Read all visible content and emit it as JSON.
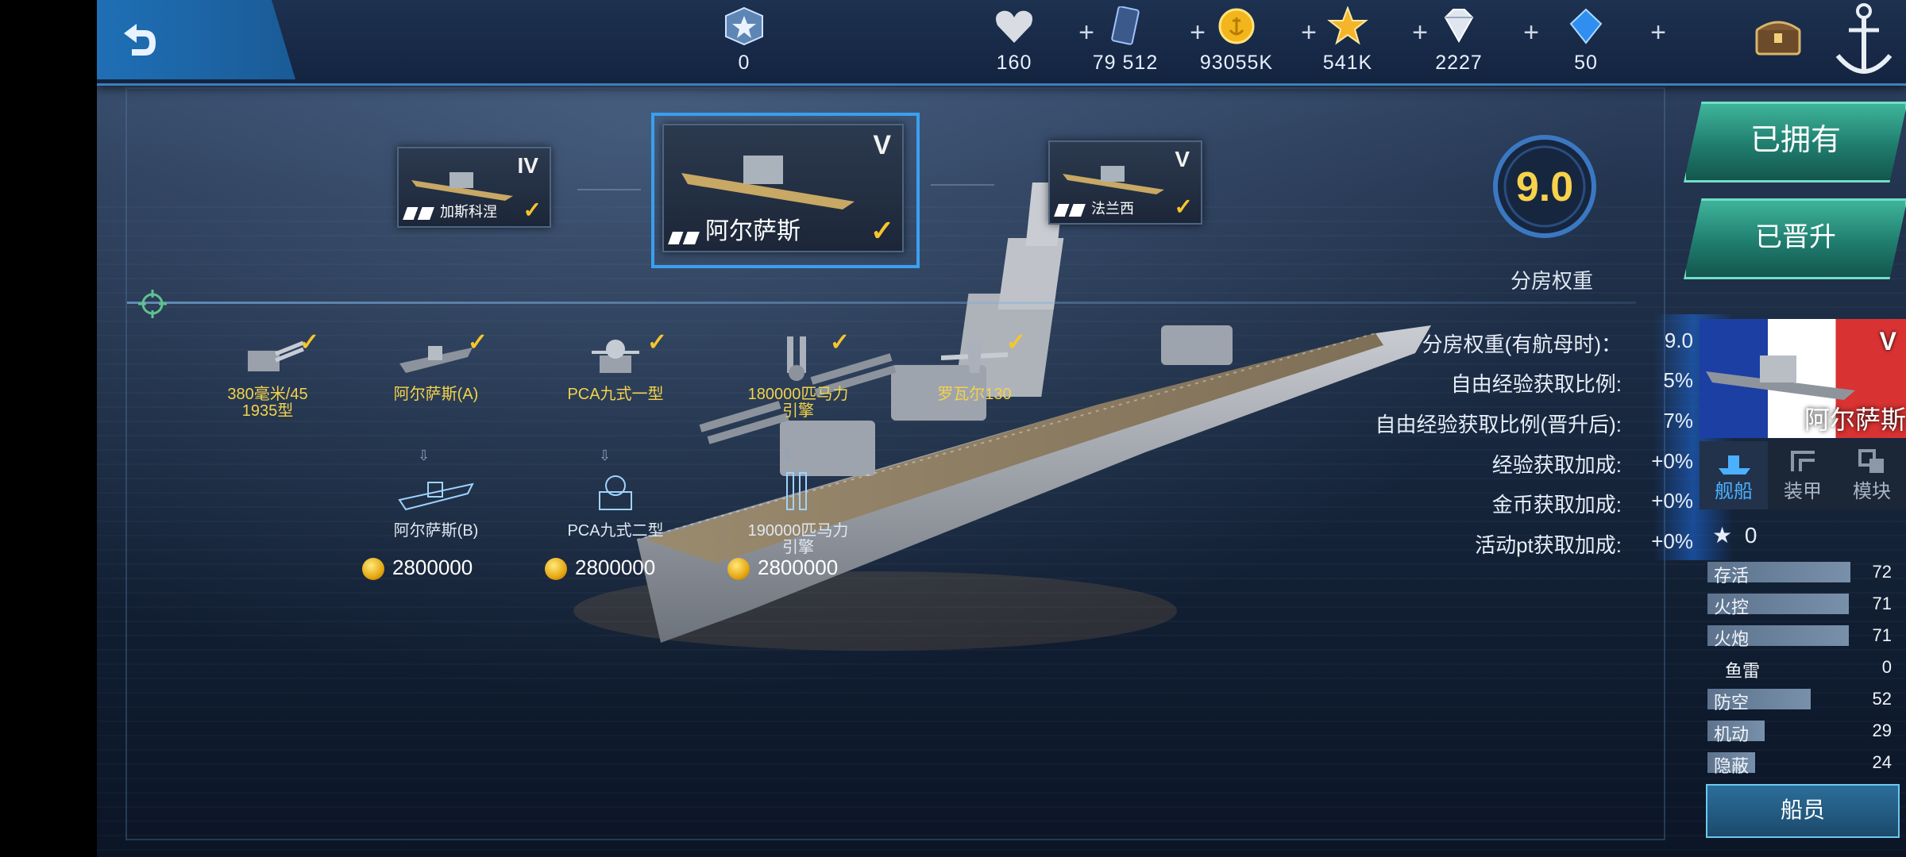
{
  "top": {
    "resources": [
      {
        "icon": "rank-badge-icon",
        "value": "0"
      },
      {
        "icon": "heart-icon",
        "value": "160"
      },
      {
        "icon": "blueprint-card-icon",
        "value": "79 512"
      },
      {
        "icon": "gold-coin-icon",
        "value": "93055K"
      },
      {
        "icon": "gold-star-icon",
        "value": "541K"
      },
      {
        "icon": "silver-diamond-icon",
        "value": "2227"
      },
      {
        "icon": "blue-gem-icon",
        "value": "50"
      }
    ],
    "plus": "+"
  },
  "tree": {
    "ships": [
      {
        "tier": "IV",
        "name": "加斯科涅"
      },
      {
        "tier": "V",
        "name": "阿尔萨斯"
      },
      {
        "tier": "V",
        "name": "法兰西"
      }
    ],
    "check": "✓"
  },
  "modules": {
    "owned": [
      {
        "label1": "380毫米/45",
        "label2": "1935型"
      },
      {
        "label1": "阿尔萨斯(A)",
        "label2": ""
      },
      {
        "label1": "PCA九式一型",
        "label2": ""
      },
      {
        "label1": "180000匹马力",
        "label2": "引擎"
      },
      {
        "label1": "罗瓦尔130",
        "label2": ""
      }
    ],
    "upgrades": [
      {
        "label1": "阿尔萨斯(B)",
        "label2": "",
        "price": "2800000"
      },
      {
        "label1": "PCA九式二型",
        "label2": "",
        "price": "2800000"
      },
      {
        "label1": "190000匹马力",
        "label2": "引擎",
        "price": "2800000"
      }
    ]
  },
  "stats": {
    "rating": "9.0",
    "rating_label": "分房权重",
    "rows": [
      {
        "k": "分房权重(有航母时)：",
        "v": "9.0"
      },
      {
        "k": "自由经验获取比例:",
        "v": "5%"
      },
      {
        "k": "自由经验获取比例(晋升后):",
        "v": "7%"
      },
      {
        "k": "经验获取加成:",
        "v": "+0%"
      },
      {
        "k": "金币获取加成:",
        "v": "+0%"
      },
      {
        "k": "活动pt获取加成:",
        "v": "+0%"
      }
    ]
  },
  "side": {
    "owned_btn": "已拥有",
    "promoted_btn": "已晋升",
    "ship_tier": "V",
    "ship_name": "阿尔萨斯",
    "tabs": [
      "舰船",
      "装甲",
      "模块"
    ],
    "stars": "0",
    "attributes": [
      {
        "k": "存活",
        "v": 72
      },
      {
        "k": "火控",
        "v": 71
      },
      {
        "k": "火炮",
        "v": 71
      },
      {
        "k": "鱼雷",
        "v": 0
      },
      {
        "k": "防空",
        "v": 52
      },
      {
        "k": "机动",
        "v": 29
      },
      {
        "k": "隐蔽",
        "v": 24
      }
    ],
    "crew_btn": "船员"
  },
  "colors": {
    "accent": "#f7c62b",
    "highlight": "#3aa0f0",
    "button_green": "#1f7d6e"
  }
}
